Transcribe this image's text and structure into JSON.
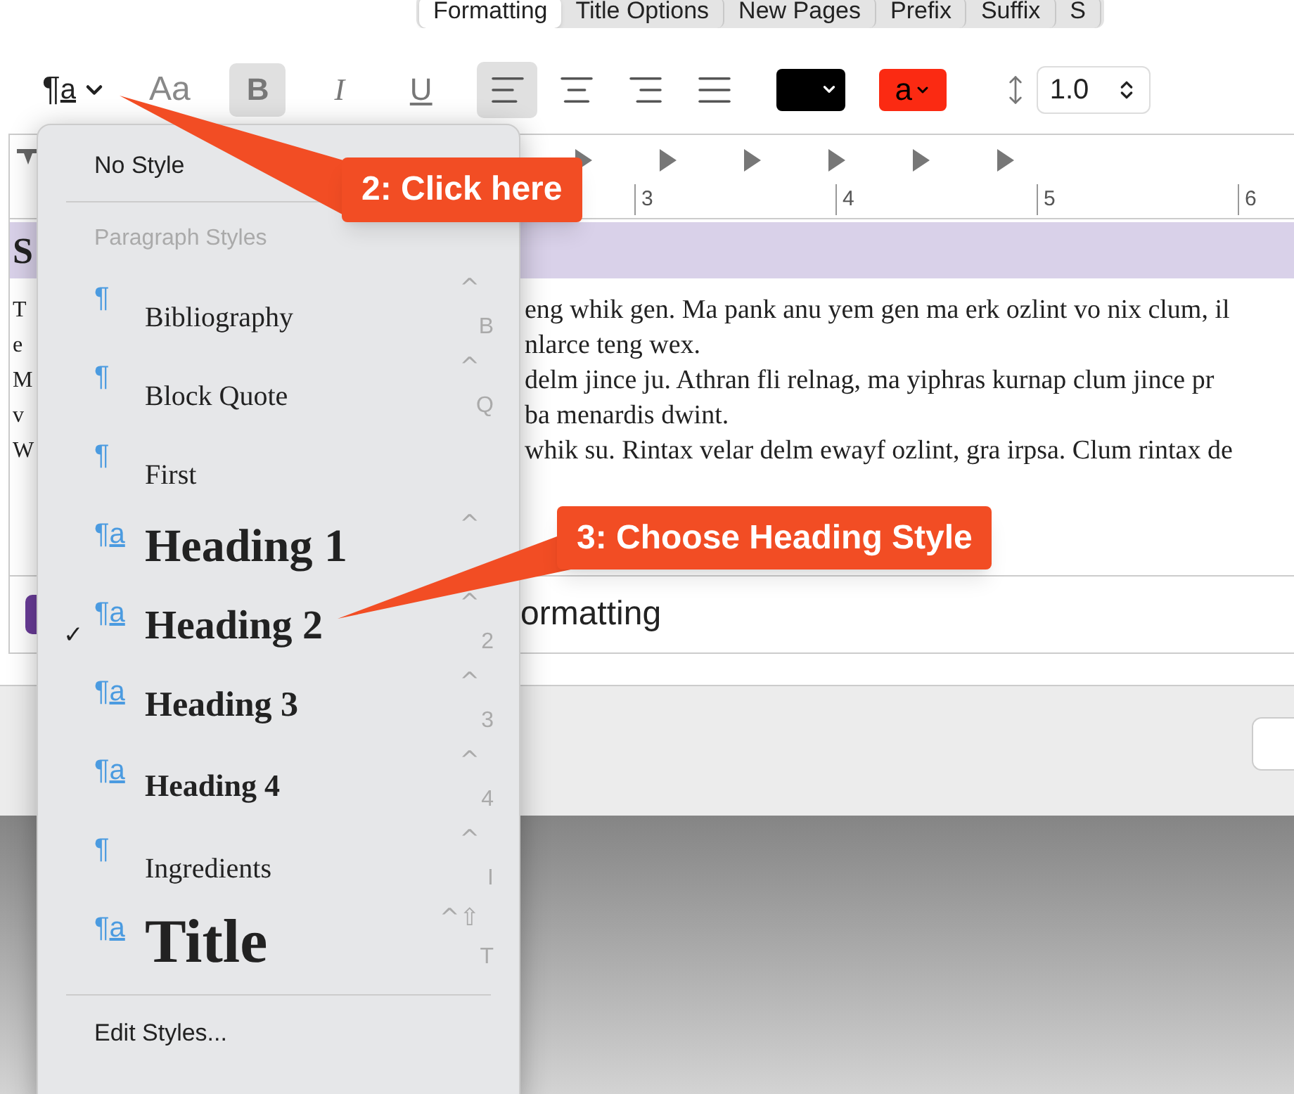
{
  "tabs": [
    {
      "label": "Formatting",
      "selected": true
    },
    {
      "label": "Title Options",
      "selected": false
    },
    {
      "label": "New Pages",
      "selected": false
    },
    {
      "label": "Prefix",
      "selected": false
    },
    {
      "label": "Suffix",
      "selected": false
    },
    {
      "label": "S",
      "selected": false
    }
  ],
  "toolbar": {
    "paragraph_button": {
      "icon": "¶",
      "icon_char": "a"
    },
    "font_button": "Aa",
    "styles": [
      {
        "kind": "bold",
        "label": "B",
        "selected": true
      },
      {
        "kind": "italic",
        "label": "I",
        "selected": false
      },
      {
        "kind": "underline",
        "label": "U",
        "selected": false
      }
    ],
    "alignments": [
      {
        "kind": "left",
        "selected": true
      },
      {
        "kind": "center",
        "selected": false
      },
      {
        "kind": "right",
        "selected": false
      },
      {
        "kind": "justify",
        "selected": false
      }
    ],
    "text_color": {
      "color": "#000000"
    },
    "highlight_color": {
      "color": "#fb2a12",
      "label": "a"
    },
    "line_spacing": "1.0"
  },
  "ruler": {
    "numbers": [
      "3",
      "4",
      "5",
      "6"
    ]
  },
  "editor": {
    "heading_fragment": "S",
    "lines": [
      {
        "left": "T",
        "right": "eng whik gen. Ma pank anu yem gen ma erk ozlint vo nix clum, il"
      },
      {
        "left": "e",
        "right": "nlarce teng wex."
      },
      {
        "left": "M",
        "right": "delm jince ju. Athran fli relnag, ma yiphras kurnap clum jince pr"
      },
      {
        "left": "v",
        "right": "ba menardis dwint."
      },
      {
        "left": "W",
        "right": "whik su. Rintax velar delm ewayf ozlint, gra irpsa. Clum rintax de"
      }
    ],
    "footer_text": "ormatting"
  },
  "menu": {
    "check_mark": "✓",
    "no_style": "No Style",
    "header": "Paragraph Styles",
    "items": [
      {
        "kind": "body",
        "label": "Bibliography",
        "icon": "¶",
        "checked": false,
        "modifier": "^",
        "key": "B"
      },
      {
        "kind": "body",
        "label": "Block Quote",
        "icon": "¶",
        "checked": false,
        "modifier": "^",
        "key": "Q"
      },
      {
        "kind": "body",
        "label": "First",
        "icon": "¶",
        "checked": false
      },
      {
        "kind": "heading1",
        "label": "Heading 1",
        "icon": "¶",
        "icon_char": "a",
        "checked": false,
        "modifier": "^"
      },
      {
        "kind": "heading2",
        "label": "Heading 2",
        "icon": "¶",
        "icon_char": "a",
        "checked": true,
        "modifier": "^",
        "key": "2"
      },
      {
        "kind": "heading3",
        "label": "Heading 3",
        "icon": "¶",
        "icon_char": "a",
        "checked": false,
        "modifier": "^",
        "key": "3"
      },
      {
        "kind": "heading4",
        "label": "Heading 4",
        "icon": "¶",
        "icon_char": "a",
        "checked": false,
        "modifier": "^",
        "key": "4"
      },
      {
        "kind": "body",
        "label": "Ingredients",
        "icon": "¶",
        "checked": false,
        "modifier": "^",
        "key": "I"
      },
      {
        "kind": "title",
        "label": "Title",
        "icon": "¶",
        "icon_char": "a",
        "checked": false,
        "modifier": "^⇧",
        "key": "T"
      }
    ],
    "edit_styles": "Edit Styles..."
  },
  "callouts": [
    {
      "text": "2: Click here"
    },
    {
      "text": "3: Choose Heading Style"
    }
  ]
}
